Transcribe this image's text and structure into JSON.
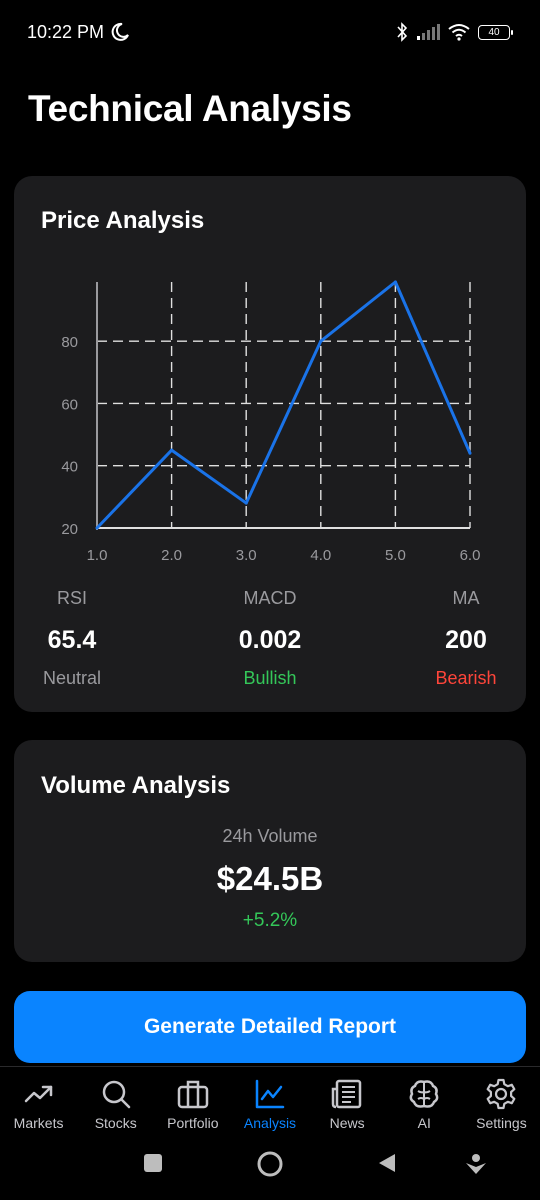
{
  "status_bar": {
    "time": "10:22 PM",
    "battery": "40"
  },
  "page": {
    "title": "Technical Analysis"
  },
  "price_card": {
    "title": "Price Analysis",
    "indicators": [
      {
        "name": "RSI",
        "value": "65.4",
        "status": "Neutral",
        "status_color": "#9a9a9e"
      },
      {
        "name": "MACD",
        "value": "0.002",
        "status": "Bullish",
        "status_color": "#34c759"
      },
      {
        "name": "MA",
        "value": "200",
        "status": "Bearish",
        "status_color": "#ff453a"
      }
    ]
  },
  "chart_data": {
    "type": "line",
    "x": [
      1.0,
      2.0,
      3.0,
      4.0,
      5.0,
      6.0
    ],
    "x_tick_labels": [
      "1.0",
      "2.0",
      "3.0",
      "4.0",
      "5.0",
      "6.0"
    ],
    "series": [
      {
        "values": [
          20,
          45,
          28,
          80,
          99,
          44
        ],
        "color": "#1a73e8"
      }
    ],
    "y_ticks": [
      20,
      40,
      60,
      80
    ],
    "xlim": [
      1.0,
      6.0
    ],
    "ylim": [
      20,
      99
    ],
    "grid": true
  },
  "volume_card": {
    "title": "Volume Analysis",
    "label": "24h Volume",
    "value": "$24.5B",
    "change": "+5.2%"
  },
  "actions": {
    "report_button": "Generate Detailed Report"
  },
  "tabs": [
    {
      "label": "Markets",
      "icon": "trending-up-icon",
      "active": false
    },
    {
      "label": "Stocks",
      "icon": "search-icon",
      "active": false
    },
    {
      "label": "Portfolio",
      "icon": "briefcase-icon",
      "active": false
    },
    {
      "label": "Analysis",
      "icon": "line-chart-icon",
      "active": true
    },
    {
      "label": "News",
      "icon": "newspaper-icon",
      "active": false
    },
    {
      "label": "AI",
      "icon": "brain-icon",
      "active": false
    },
    {
      "label": "Settings",
      "icon": "gear-icon",
      "active": false
    }
  ],
  "colors": {
    "accent": "#0a84ff",
    "card": "#1c1c1e",
    "positive": "#34c759",
    "negative": "#ff453a"
  }
}
